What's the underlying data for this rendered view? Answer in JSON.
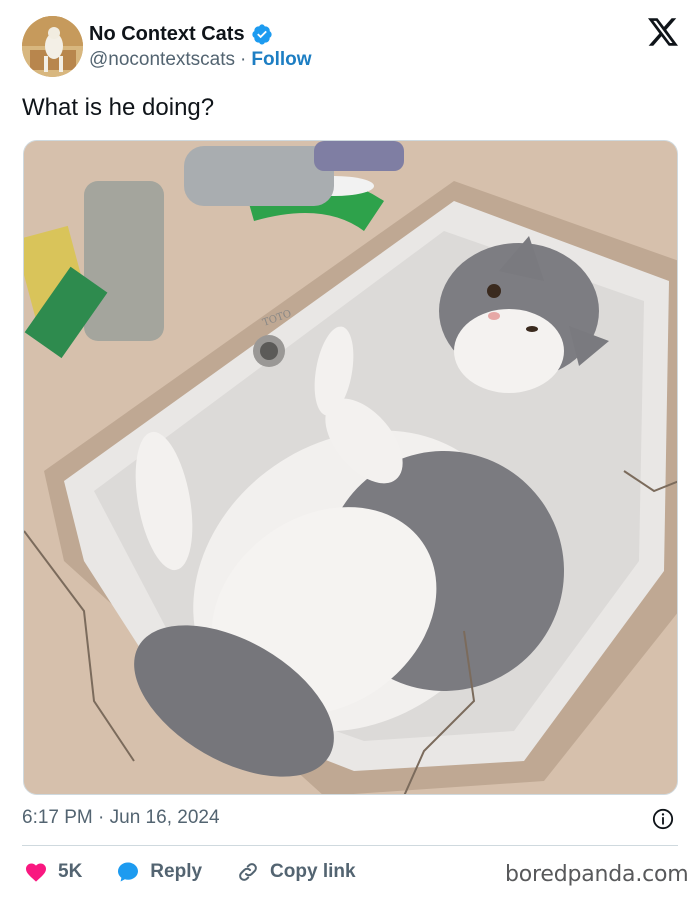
{
  "author": {
    "display_name": "No Context Cats",
    "handle": "@nocontextscats",
    "separator": "·",
    "follow_label": "Follow",
    "verified": true,
    "avatar_icon": "avatar-cat-image"
  },
  "tweet": {
    "text": "What is he doing?",
    "image_alt": "Grey and white cat lying on its back in a bathroom sink",
    "image_sink_brand": "TOTO",
    "timestamp": "6:17 PM · Jun 16, 2024"
  },
  "actions": {
    "like_count": "5K",
    "reply_label": "Reply",
    "copy_label": "Copy link"
  },
  "icons": {
    "logo": "x-logo-icon",
    "verified": "verified-badge-icon",
    "info": "info-icon",
    "like": "heart-icon",
    "reply": "reply-bubble-icon",
    "copy": "link-icon"
  },
  "colors": {
    "link_blue": "#1d7ec3",
    "verified_blue": "#1d9bf0",
    "heart_red": "#f91880",
    "text_primary": "#0f1419",
    "text_secondary": "#536471"
  },
  "watermark": "boredpanda.com"
}
